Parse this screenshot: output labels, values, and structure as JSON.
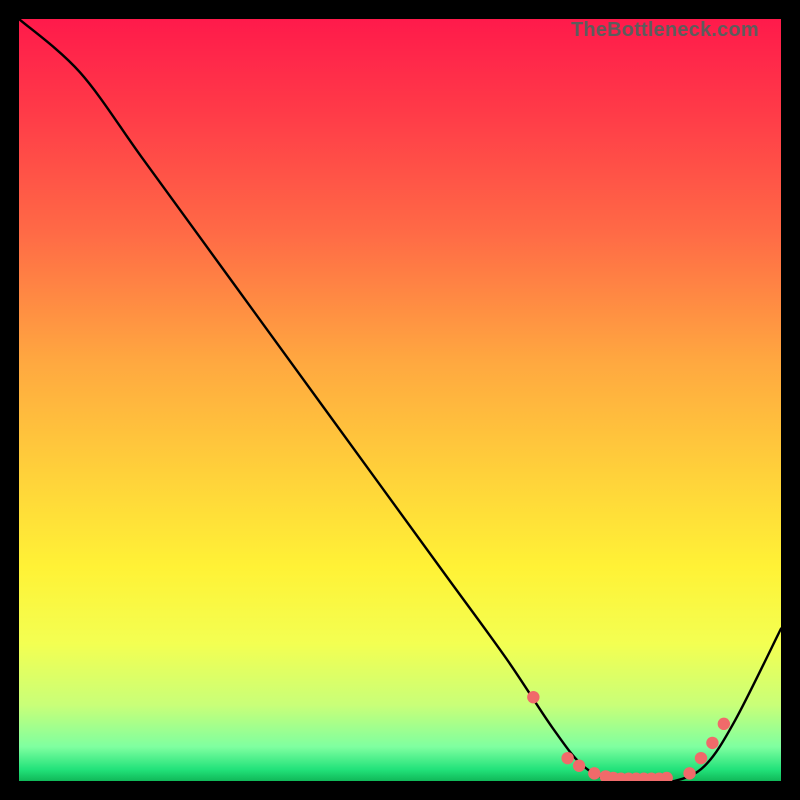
{
  "watermark": "TheBottleneck.com",
  "chart_data": {
    "type": "line",
    "title": "",
    "xlabel": "",
    "ylabel": "",
    "xlim": [
      0,
      100
    ],
    "ylim": [
      0,
      100
    ],
    "grid": false,
    "legend": false,
    "series": [
      {
        "name": "curve",
        "x": [
          0,
          8,
          16,
          24,
          32,
          40,
          48,
          56,
          64,
          70,
          74,
          78,
          82,
          86,
          90,
          94,
          100
        ],
        "y": [
          100,
          93,
          82,
          71,
          60,
          49,
          38,
          27,
          16,
          7,
          2,
          0,
          0,
          0,
          2,
          8,
          20
        ]
      }
    ],
    "markers": {
      "name": "dots",
      "color": "#f06a6a",
      "x": [
        67.5,
        72,
        73.5,
        75.5,
        77,
        78,
        79,
        80,
        81,
        82,
        83,
        84,
        85,
        88,
        89.5,
        91,
        92.5
      ],
      "y": [
        11,
        3,
        2,
        1,
        0.6,
        0.4,
        0.3,
        0.3,
        0.3,
        0.3,
        0.3,
        0.3,
        0.4,
        1,
        3,
        5,
        7.5
      ]
    },
    "gradient": {
      "stops": [
        {
          "offset": 0.0,
          "color": "#ff1a4b"
        },
        {
          "offset": 0.12,
          "color": "#ff3a48"
        },
        {
          "offset": 0.28,
          "color": "#ff6a46"
        },
        {
          "offset": 0.45,
          "color": "#ffa840"
        },
        {
          "offset": 0.6,
          "color": "#ffd23a"
        },
        {
          "offset": 0.72,
          "color": "#fff236"
        },
        {
          "offset": 0.82,
          "color": "#f3ff52"
        },
        {
          "offset": 0.9,
          "color": "#c9ff78"
        },
        {
          "offset": 0.955,
          "color": "#7fffa0"
        },
        {
          "offset": 0.985,
          "color": "#22e27a"
        },
        {
          "offset": 1.0,
          "color": "#10b858"
        }
      ]
    }
  }
}
